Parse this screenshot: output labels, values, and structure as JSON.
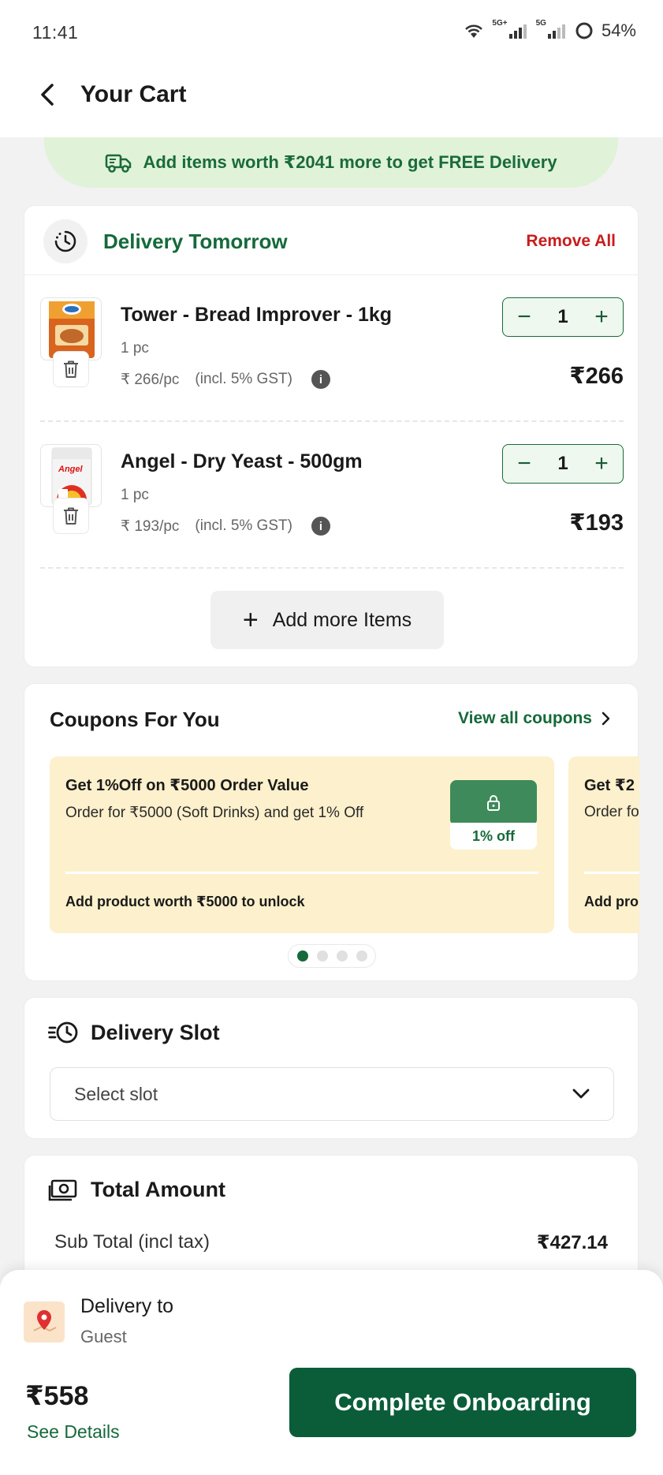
{
  "status_bar": {
    "time": "11:41",
    "network_1": "5G+",
    "network_2": "5G",
    "battery": "54%"
  },
  "header": {
    "title": "Your Cart"
  },
  "free_delivery_banner": {
    "text": "Add items worth ₹2041 more to get FREE Delivery"
  },
  "delivery_group": {
    "label": "Delivery Tomorrow",
    "remove_all": "Remove All"
  },
  "items": [
    {
      "name": "Tower - Bread Improver - 1kg",
      "qty_label": "1 pc",
      "unit_price": "₹ 266/pc",
      "tax_note": "(incl. 5% GST)",
      "quantity": "1",
      "price": "₹266"
    },
    {
      "name": "Angel - Dry Yeast - 500gm",
      "qty_label": "1 pc",
      "unit_price": "₹ 193/pc",
      "tax_note": "(incl. 5% GST)",
      "quantity": "1",
      "price": "₹193"
    }
  ],
  "add_more": {
    "label": "Add more Items"
  },
  "coupons": {
    "title": "Coupons For You",
    "view_all": "View all coupons",
    "cards": [
      {
        "title": "Get 1%Off on ₹5000 Order Value",
        "desc": "Order for ₹5000 (Soft Drinks) and get 1% Off",
        "badge": "1% off",
        "unlock": "Add product worth ₹5000 to unlock"
      },
      {
        "title": "Get ₹2",
        "desc": "Order fo",
        "unlock": "Add pro"
      }
    ],
    "page_count": 4,
    "active_page": 0
  },
  "delivery_slot": {
    "title": "Delivery Slot",
    "placeholder": "Select slot"
  },
  "total_amount": {
    "title": "Total Amount",
    "subtotal_label": "Sub Total (incl tax)",
    "subtotal_value": "₹427.14"
  },
  "bottom_bar": {
    "delivery_to_label": "Delivery to",
    "delivery_name": "Guest",
    "total": "₹558",
    "see_details": "See Details",
    "cta": "Complete Onboarding"
  },
  "colors": {
    "brand_green": "#0b5d3a",
    "accent_green": "#15693a",
    "remove_red": "#c81d1d",
    "coupon_bg": "#fdf0cc",
    "banner_bg": "#e0f2d8"
  }
}
